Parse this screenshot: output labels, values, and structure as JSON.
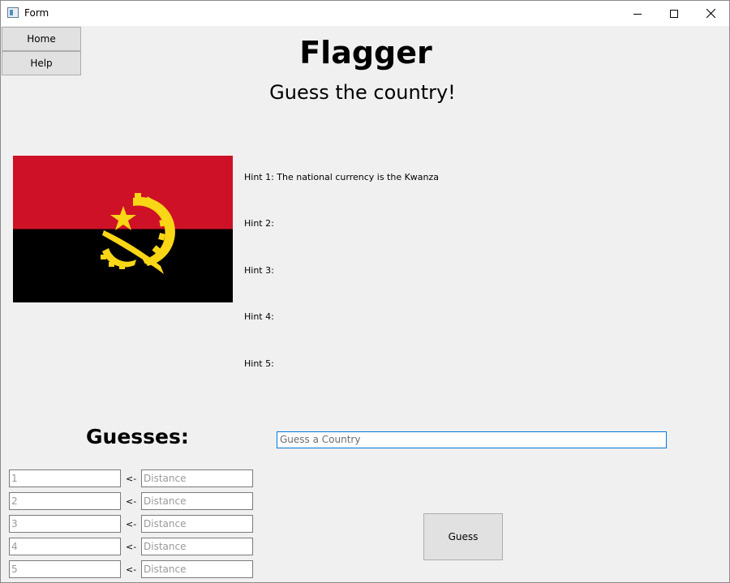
{
  "window": {
    "title": "Form"
  },
  "nav": {
    "home": "Home",
    "help": "Help"
  },
  "header": {
    "title": "Flagger",
    "subtitle": "Guess the country!"
  },
  "flag": {
    "country_colors": {
      "top": "#ce1126",
      "bottom": "#000000",
      "emblem": "#f9d616"
    }
  },
  "hints": [
    "Hint 1: The national currency is the Kwanza",
    "Hint 2:",
    "Hint 3:",
    "Hint 4:",
    "Hint 5:"
  ],
  "guesses": {
    "heading": "Guesses:",
    "arrow": "<-",
    "rows": [
      {
        "number": "1",
        "distance": "Distance"
      },
      {
        "number": "2",
        "distance": "Distance"
      },
      {
        "number": "3",
        "distance": "Distance"
      },
      {
        "number": "4",
        "distance": "Distance"
      },
      {
        "number": "5",
        "distance": "Distance"
      }
    ]
  },
  "guess_input": {
    "placeholder": "Guess a Country"
  },
  "guess_button": {
    "label": "Guess"
  },
  "icons": {
    "app": "app-window-icon",
    "minimize": "minimize-icon",
    "maximize": "maximize-icon",
    "close": "close-icon"
  }
}
